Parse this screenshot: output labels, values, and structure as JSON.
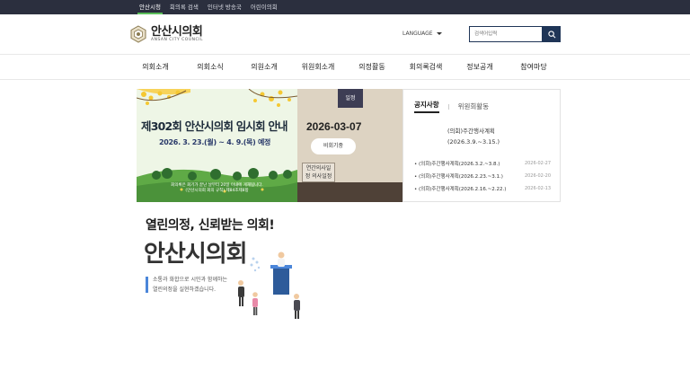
{
  "topbar": {
    "links": [
      {
        "label": "안산시청",
        "active": true
      },
      {
        "label": "회의록 검색",
        "active": false
      },
      {
        "label": "인터넷 방송국",
        "active": false
      },
      {
        "label": "어린이의회",
        "active": false
      }
    ]
  },
  "header": {
    "logo_main": "안산시의회",
    "logo_sub": "ANSAN CITY COUNCIL",
    "language_label": "LANGUAGE",
    "search_placeholder": "검색어입력"
  },
  "gnb": {
    "items": [
      "의회소개",
      "의회소식",
      "의원소개",
      "위원회소개",
      "의정활동",
      "회의록검색",
      "정보공개",
      "참여마당"
    ]
  },
  "banner": {
    "title": "제302회 안산시의회 임시회 안내",
    "date_range": "2026. 3. 23.(월) ~ 4. 9.(목) 예정",
    "footnote_1": "회의록은 회기가 끝난 날부터 20일 이내에 게재됩니다.",
    "footnote_2": "(안산시의회 회의 규칙) 제84조제8항"
  },
  "schedule": {
    "tag": "일정",
    "date": "2026-03-07",
    "status": "비회기중",
    "link_label": "연간의사일정 의사일정"
  },
  "notice": {
    "tabs": [
      {
        "label": "공지사항",
        "active": true
      },
      {
        "label": "위원회활동",
        "active": false
      }
    ],
    "featured_line1": "(의회)주간행사계획",
    "featured_line2": "(2026.3.9.~3.15.)",
    "items": [
      {
        "title": "(의회)주간행사계획(2026.3.2.~3.8.)",
        "date": "2026-02-27"
      },
      {
        "title": "(의회)주간행사계획(2026.2.23.~3.1.)",
        "date": "2026-02-20"
      },
      {
        "title": "(의회)주간행사계획(2026.2.16.~2.22.)",
        "date": "2026-02-13"
      }
    ]
  },
  "slogan": {
    "headline": "열린의정, 신뢰받는 의회!",
    "big": "안산시의회",
    "desc_1": "소통과 화합으로 시민과 함께하는",
    "desc_2": "열린의정을 실현하겠습니다."
  },
  "colors": {
    "topbar_bg": "#2b2f3e",
    "accent_green": "#5bbf5a",
    "search_button": "#1f3557",
    "schedule_tag": "#3d3d54"
  }
}
